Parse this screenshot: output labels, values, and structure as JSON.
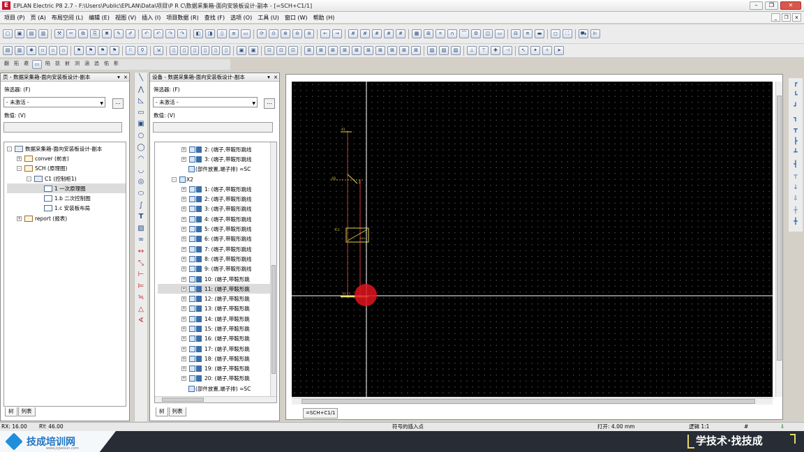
{
  "window": {
    "title": "EPLAN Electric P8 2.7 - F:\\Users\\Public\\EPLAN\\Data\\项目\\P R C\\数据采集箱-面向安装板设计-副本 - [=SCH+C1/1]",
    "logo": "E"
  },
  "menu": {
    "items": [
      "项目 (P)",
      "页 (A)",
      "布局空间 (L)",
      "编辑 (E)",
      "视图 (V)",
      "插入 (I)",
      "项目数据 (R)",
      "查找 (F)",
      "选项 (O)",
      "工具 (U)",
      "窗口 (W)",
      "帮助 (H)"
    ]
  },
  "toolbar3": {
    "items": [
      "翻",
      "拓",
      "邀",
      "陷",
      "捻",
      "射",
      "浏",
      "涵",
      "追",
      "佑",
      "影"
    ]
  },
  "page_panel": {
    "title": "页 - 数据采集箱-面向安装板设计-副本",
    "filter_label": "筛选器: (F)",
    "filter_value": "- 未激活 -",
    "value_label": "数值: (V)",
    "tree": [
      {
        "label": "数据采集箱-面向安装板设计-副本",
        "indent": 0,
        "exp": "-",
        "icon": "project"
      },
      {
        "label": "conver (前言)",
        "indent": 1,
        "exp": "+",
        "icon": "doc"
      },
      {
        "label": "SCH (原理图)",
        "indent": 1,
        "exp": "-",
        "icon": "doc"
      },
      {
        "label": "C1 (控制柜1)",
        "indent": 2,
        "exp": "-",
        "icon": "folder"
      },
      {
        "label": "1 一次原理图",
        "indent": 3,
        "exp": "",
        "icon": "page",
        "selected": true
      },
      {
        "label": "1.b 二次控制图",
        "indent": 3,
        "exp": "",
        "icon": "page"
      },
      {
        "label": "1.c 安装板布局",
        "indent": 3,
        "exp": "",
        "icon": "page"
      },
      {
        "label": "report (报表)",
        "indent": 1,
        "exp": "+",
        "icon": "doc"
      }
    ],
    "tabs": [
      "树",
      "列表"
    ]
  },
  "device_panel": {
    "title": "设备 - 数据采集箱-面向安装板设计-副本",
    "filter_label": "筛选器: (F)",
    "filter_value": "- 未激活 -",
    "value_label": "数值: (V)",
    "tree": [
      {
        "label": "2: (端子,带鞍形跳线",
        "indent": 2
      },
      {
        "label": "3: (端子,带鞍形跳线",
        "indent": 2
      },
      {
        "label": "(部件放置,端子排) =SC",
        "indent": 2,
        "special": "placement"
      },
      {
        "label": "X2",
        "indent": 1,
        "special": "strip"
      },
      {
        "label": "1: (端子,带鞍形跳线",
        "indent": 2
      },
      {
        "label": "2: (端子,带鞍形跳线",
        "indent": 2
      },
      {
        "label": "3: (端子,带鞍形跳线",
        "indent": 2
      },
      {
        "label": "4: (端子,带鞍形跳线",
        "indent": 2
      },
      {
        "label": "5: (端子,带鞍形跳线",
        "indent": 2
      },
      {
        "label": "6: (端子,带鞍形跳线",
        "indent": 2
      },
      {
        "label": "7: (端子,带鞍形跳线",
        "indent": 2
      },
      {
        "label": "8: (端子,带鞍形跳线",
        "indent": 2
      },
      {
        "label": "9: (端子,带鞍形跳线",
        "indent": 2
      },
      {
        "label": "10: (端子,带鞍形跳",
        "indent": 2
      },
      {
        "label": "11: (端子,带鞍形跳",
        "indent": 2,
        "selected": true
      },
      {
        "label": "12: (端子,带鞍形跳",
        "indent": 2
      },
      {
        "label": "13: (端子,带鞍形跳",
        "indent": 2
      },
      {
        "label": "14: (端子,带鞍形跳",
        "indent": 2
      },
      {
        "label": "15: (端子,带鞍形跳",
        "indent": 2
      },
      {
        "label": "16: (端子,带鞍形跳",
        "indent": 2
      },
      {
        "label": "17: (端子,带鞍形跳",
        "indent": 2
      },
      {
        "label": "18: (端子,带鞍形跳",
        "indent": 2
      },
      {
        "label": "19: (端子,带鞍形跳",
        "indent": 2
      },
      {
        "label": "20: (端子,带鞍形跳",
        "indent": 2
      },
      {
        "label": "(部件放置,端子排) =SC",
        "indent": 2,
        "special": "placement"
      }
    ],
    "tabs": [
      "树",
      "列表"
    ]
  },
  "canvas": {
    "tab_label": "=SCH+C1/1",
    "background": "#000000",
    "symbol_color": "#e6d64a",
    "wire_color": "#c7343a",
    "crosshair_color": "#ffffff",
    "cursor_color": "#e0141e",
    "labels": {
      "top_small": "-X1",
      "mid_left": "-Q1",
      "mid_right": "1",
      "module_left": "-TC1",
      "module_right": "24V",
      "bottom": "-X2 1 2"
    }
  },
  "status": {
    "rx": "RX: 16.00",
    "ry": "RY: 46.00",
    "hint": "符号的插入点",
    "grid": "打开: 4.00 mm",
    "logic": "逻辑 1:1",
    "hash": "#"
  },
  "banner": {
    "brand": "技成培训网",
    "brand_sub": "www.jcpeixun.com",
    "slogan": "学技术·找技成"
  }
}
